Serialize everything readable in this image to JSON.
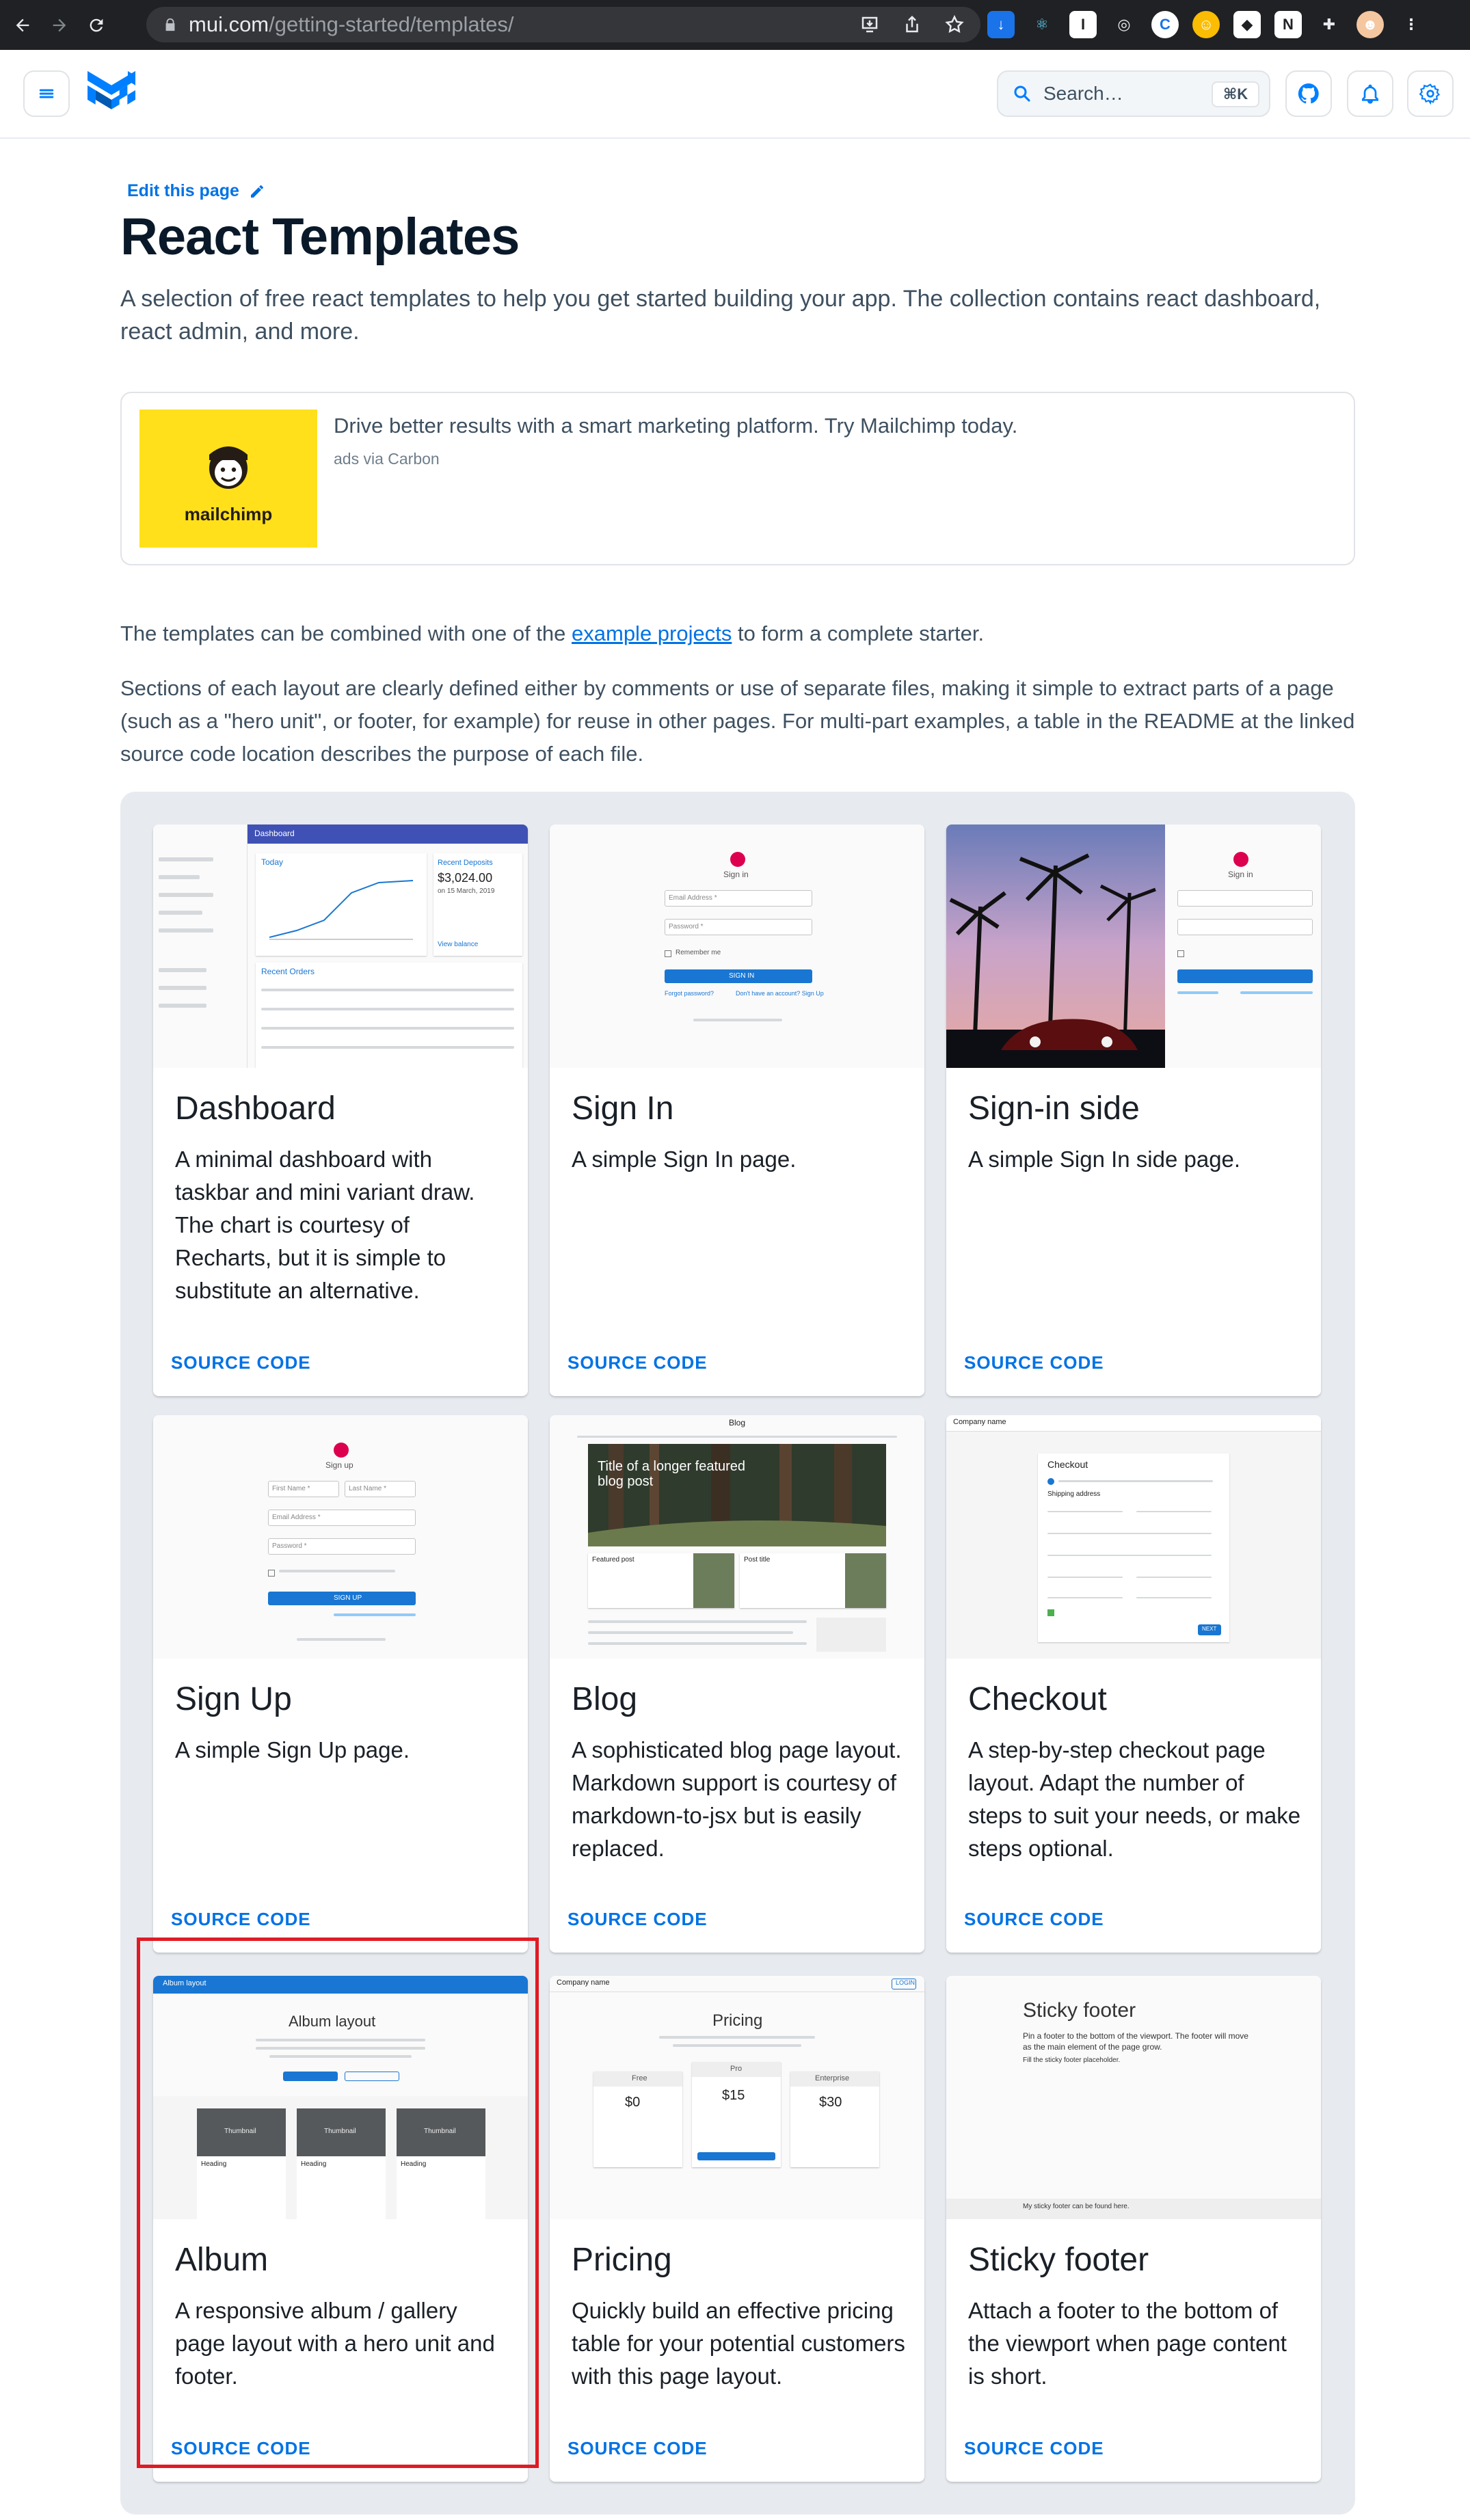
{
  "browser": {
    "url_host": "mui.com",
    "url_path": "/getting-started/templates/"
  },
  "header": {
    "search_placeholder": "Search…",
    "search_shortcut": "⌘K"
  },
  "page": {
    "edit_link": "Edit this page",
    "title": "React Templates",
    "lead": "A selection of free react templates to help you get started building your app. The collection contains react dashboard, react admin, and more.",
    "p1_before": "The templates can be combined with one of the ",
    "p1_link": "example projects",
    "p1_after": " to form a complete starter.",
    "p2": "Sections of each layout are clearly defined either by comments or use of separate files, making it simple to extract parts of a page (such as a \"hero unit\", or footer, for example) for reuse in other pages. For multi-part examples, a table in the README at the linked source code location describes the purpose of each file."
  },
  "ad": {
    "brand": "mailchimp",
    "text": "Drive better results with a smart marketing platform. Try Mailchimp today.",
    "sub": "ads via Carbon"
  },
  "templates": [
    {
      "title": "Dashboard",
      "desc": "A minimal dashboard with taskbar and mini variant draw. The chart is courtesy of Recharts, but it is simple to substitute an alternative.",
      "source": "SOURCE CODE"
    },
    {
      "title": "Sign In",
      "desc": "A simple Sign In page.",
      "source": "SOURCE CODE"
    },
    {
      "title": "Sign-in side",
      "desc": "A simple Sign In side page.",
      "source": "SOURCE CODE"
    },
    {
      "title": "Sign Up",
      "desc": "A simple Sign Up page.",
      "source": "SOURCE CODE"
    },
    {
      "title": "Blog",
      "desc": "A sophisticated blog page layout. Markdown support is courtesy of markdown-to-jsx but is easily replaced.",
      "source": "SOURCE CODE"
    },
    {
      "title": "Checkout",
      "desc": "A step-by-step checkout page layout. Adapt the number of steps to suit your needs, or make steps optional.",
      "source": "SOURCE CODE"
    },
    {
      "title": "Album",
      "desc": "A responsive album / gallery page layout with a hero unit and footer.",
      "source": "SOURCE CODE"
    },
    {
      "title": "Pricing",
      "desc": "Quickly build an effective pricing table for your potential customers with this page layout.",
      "source": "SOURCE CODE"
    },
    {
      "title": "Sticky footer",
      "desc": "Attach a footer to the bottom of the viewport when page content is short.",
      "source": "SOURCE CODE"
    }
  ],
  "thumbs": {
    "dashboard": {
      "bar": "Dashboard",
      "today": "Today",
      "deposits_label": "Recent Deposits",
      "deposits_value": "$3,024.00",
      "deposits_date": "on 15 March, 2019",
      "orders": "Recent Orders",
      "view_balance": "View balance"
    },
    "signin": {
      "label": "Sign in",
      "email": "Email Address *",
      "password": "Password *",
      "remember": "Remember me",
      "button": "SIGN IN",
      "forgot": "Forgot password?",
      "signup": "Don't have an account? Sign Up"
    },
    "signup": {
      "label": "Sign up",
      "first": "First Name *",
      "last": "Last Name *",
      "email": "Email Address *",
      "password": "Password *",
      "button": "SIGN UP"
    },
    "blog": {
      "title": "Title of a longer featured blog post",
      "bar": "Blog",
      "featured": "Featured post",
      "post": "Post title"
    },
    "checkout": {
      "company": "Company name",
      "heading": "Checkout",
      "shipping": "Shipping address",
      "next": "NEXT"
    },
    "album": {
      "bar": "Album layout",
      "heading": "Album layout",
      "thumb": "Thumbnail",
      "card_heading": "Heading"
    },
    "pricing": {
      "company": "Company name",
      "heading": "Pricing",
      "tiers": [
        "Free",
        "Pro",
        "Enterprise"
      ],
      "prices": [
        "$0",
        "$15",
        "$30"
      ],
      "login": "LOGIN"
    },
    "sticky": {
      "heading": "Sticky footer",
      "body": "Pin a footer to the bottom of the viewport. The footer will move as the main element of the page grow.",
      "placeholder": "Fill the sticky footer placeholder.",
      "footer": "My sticky footer can be found here."
    }
  },
  "colors": {
    "accent": "#0072e5",
    "highlight": "#e01b24",
    "grid_bg": "#e7ebf0",
    "mailchimp": "#ffe01b"
  }
}
